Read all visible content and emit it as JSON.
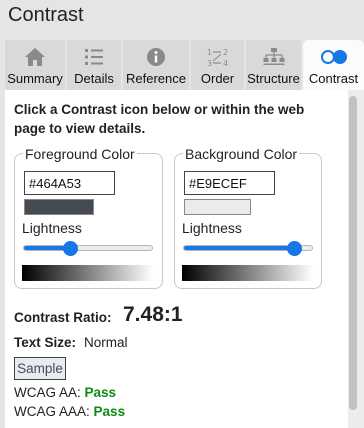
{
  "window": {
    "title": "Contrast"
  },
  "tabs": [
    {
      "label": "Summary",
      "icon": "home-icon"
    },
    {
      "label": "Details",
      "icon": "list-icon"
    },
    {
      "label": "Reference",
      "icon": "info-icon"
    },
    {
      "label": "Order",
      "icon": "order-icon"
    },
    {
      "label": "Structure",
      "icon": "structure-icon"
    },
    {
      "label": "Contrast",
      "icon": "contrast-icon",
      "active": true
    }
  ],
  "intro": "Click a Contrast icon below or within the web page to view details.",
  "foreground": {
    "legend": "Foreground Color",
    "hex": "#464A53",
    "swatch": "#464a53",
    "lightness_label": "Lightness",
    "lightness_fraction": 0.36
  },
  "background": {
    "legend": "Background Color",
    "hex": "#E9ECEF",
    "swatch": "#e9ecef",
    "lightness_label": "Lightness",
    "lightness_fraction": 0.86
  },
  "ratio": {
    "label": "Contrast Ratio:",
    "value": "7.48:1"
  },
  "text_size": {
    "label": "Text Size:",
    "value": "Normal"
  },
  "sample": {
    "label": "Sample"
  },
  "wcag_aa": {
    "label": "WCAG AA:",
    "result": "Pass"
  },
  "wcag_aaa": {
    "label": "WCAG AAA:",
    "result": "Pass"
  },
  "colors": {
    "accent": "#1677e6",
    "pass": "#118a11",
    "tab_active": "#fbfbfb",
    "tab_inactive": "#d9d9d9"
  }
}
